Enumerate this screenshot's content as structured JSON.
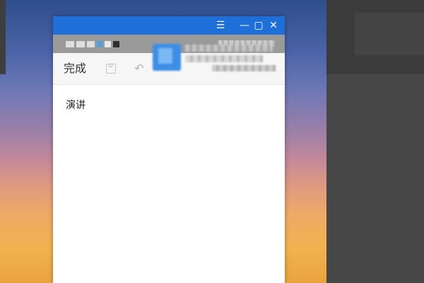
{
  "window": {
    "titlebar": {
      "menu_icon": "list-icon",
      "minimize_icon": "minimize-icon",
      "maximize_icon": "maximize-icon",
      "close_icon": "close-icon"
    },
    "statusbar": {
      "icons": [
        "signal-icon",
        "sim-icon",
        "wifi-icon",
        "app-icon",
        "notification-icon",
        "tiktok-icon"
      ]
    }
  },
  "toolbar": {
    "done_label": "完成",
    "save_icon": "save-icon",
    "undo_icon": "undo-icon"
  },
  "note": {
    "text": "演讲"
  },
  "colors": {
    "titlebar": "#1e6fd8",
    "statusbar": "#9a9a9a",
    "toolbar": "#f6f6f6"
  }
}
